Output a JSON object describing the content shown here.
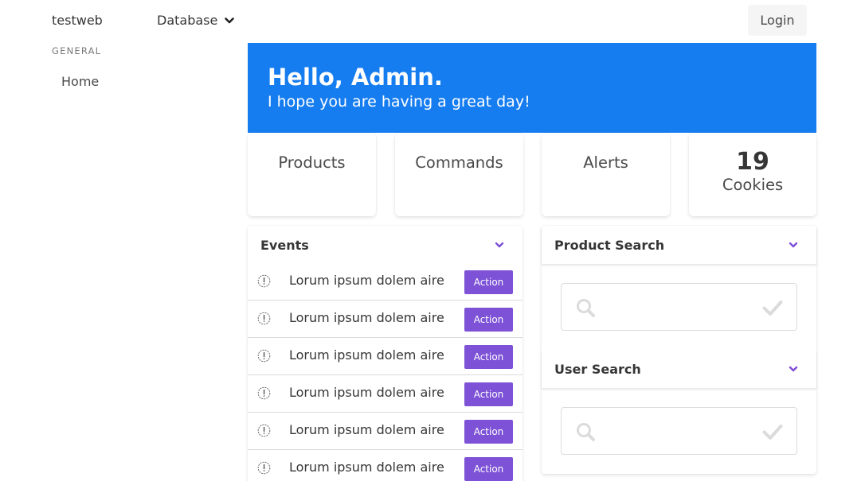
{
  "navbar": {
    "brand": "testweb",
    "database_label": "Database",
    "login_label": "Login"
  },
  "sidebar": {
    "section_label": "GENERAL",
    "items": [
      {
        "label": "Home"
      }
    ]
  },
  "hero": {
    "title": "Hello, Admin.",
    "subtitle": "I hope you are having a great day!"
  },
  "tiles": [
    {
      "label": "Products"
    },
    {
      "label": "Commands"
    },
    {
      "label": "Alerts"
    },
    {
      "value": "19",
      "label": "Cookies"
    }
  ],
  "events": {
    "title": "Events",
    "rows": [
      {
        "text": "Lorum ipsum dolem aire",
        "action": "Action"
      },
      {
        "text": "Lorum ipsum dolem aire",
        "action": "Action"
      },
      {
        "text": "Lorum ipsum dolem aire",
        "action": "Action"
      },
      {
        "text": "Lorum ipsum dolem aire",
        "action": "Action"
      },
      {
        "text": "Lorum ipsum dolem aire",
        "action": "Action"
      },
      {
        "text": "Lorum ipsum dolem aire",
        "action": "Action"
      }
    ]
  },
  "product_search": {
    "title": "Product Search",
    "value": "",
    "placeholder": ""
  },
  "user_search": {
    "title": "User Search",
    "value": "",
    "placeholder": ""
  },
  "colors": {
    "hero": "#167df0",
    "accent": "#7d52d6",
    "icon_muted": "#dbdbdb"
  },
  "icons": {
    "dropdown": "chevron-down-icon",
    "event": "exclamation-circle-icon",
    "search": "search-icon",
    "confirm": "check-icon"
  }
}
